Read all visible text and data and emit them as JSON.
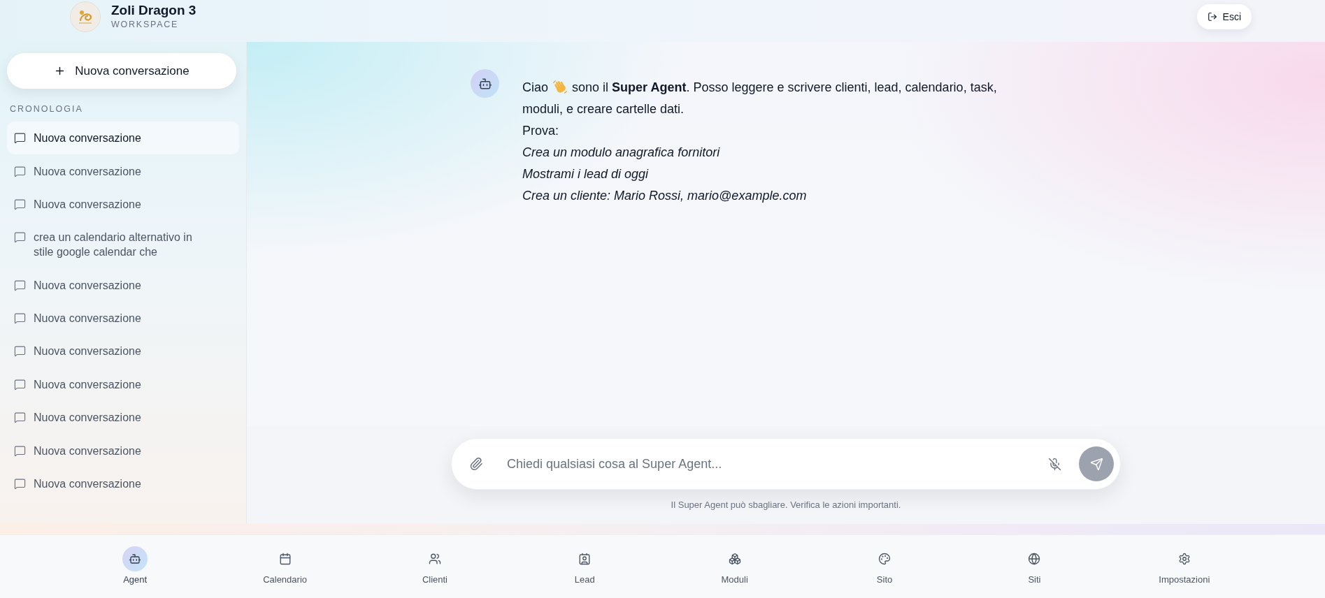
{
  "workspace": {
    "name": "Zoli Dragon 3",
    "subtitle": "WORKSPACE"
  },
  "header": {
    "logout_label": "Esci"
  },
  "sidebar": {
    "new_conversation": "Nuova conversazione",
    "section_title": "CRONOLOGIA",
    "items": [
      {
        "label": "Nuova conversazione",
        "selected": true
      },
      {
        "label": "Nuova conversazione",
        "selected": false
      },
      {
        "label": "Nuova conversazione",
        "selected": false
      },
      {
        "label": "crea un calendario alternativo in stile google calendar che",
        "selected": false
      },
      {
        "label": "Nuova conversazione",
        "selected": false
      },
      {
        "label": "Nuova conversazione",
        "selected": false
      },
      {
        "label": "Nuova conversazione",
        "selected": false
      },
      {
        "label": "Nuova conversazione",
        "selected": false
      },
      {
        "label": "Nuova conversazione",
        "selected": false
      },
      {
        "label": "Nuova conversazione",
        "selected": false
      },
      {
        "label": "Nuova conversazione",
        "selected": false
      }
    ]
  },
  "chat": {
    "messages": [
      {
        "greeting": "Ciao",
        "intro": "sono il **Super Agent**. Posso leggere e scrivere clienti, lead, calendario, task, moduli, e creare cartelle dati.",
        "prompt_label": "Prova:",
        "examples": [
          "Crea un modulo anagrafica fornitori",
          "Mostrami i lead di oggi",
          "Crea un cliente: Mario Rossi, mario@example.com"
        ]
      }
    ]
  },
  "composer": {
    "placeholder": "Chiedi qualsiasi cosa al Super Agent...",
    "send_disabled": true,
    "disclaimer": "Il Super Agent può sbagliare. Verifica le azioni importanti."
  },
  "bottom_nav": [
    {
      "label": "Agent",
      "selected": true
    },
    {
      "label": "Calendario",
      "selected": false
    },
    {
      "label": "Clienti",
      "selected": false
    },
    {
      "label": "Lead",
      "selected": false
    },
    {
      "label": "Moduli",
      "selected": false
    },
    {
      "label": "Sito",
      "selected": false
    },
    {
      "label": "Siti",
      "selected": false
    },
    {
      "label": "Impostazioni",
      "selected": false
    }
  ]
}
